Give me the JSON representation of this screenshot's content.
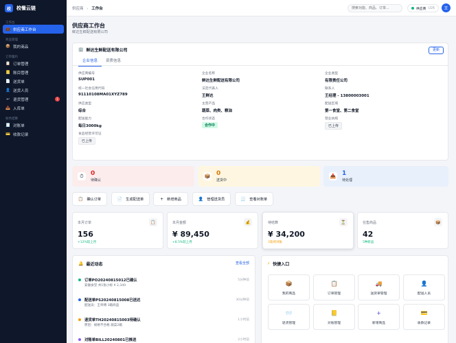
{
  "app": {
    "logo_char": "校",
    "name": "校餐云链"
  },
  "sidebar": {
    "sections": [
      {
        "title": "工作台",
        "items": [
          {
            "label": "供应商工作台",
            "icon": "briefcase-icon",
            "glyph": "💼",
            "active": true
          }
        ]
      },
      {
        "title": "商品管理",
        "items": [
          {
            "label": "我的商品",
            "icon": "box-icon",
            "glyph": "📦"
          }
        ]
      },
      {
        "title": "订单履约",
        "items": [
          {
            "label": "订单管理",
            "icon": "order-icon",
            "glyph": "📋"
          },
          {
            "label": "账目管理",
            "icon": "ledger-icon",
            "glyph": "📒"
          },
          {
            "label": "送货单",
            "icon": "delivery-note-icon",
            "glyph": "📄"
          },
          {
            "label": "送货人员",
            "icon": "courier-icon",
            "glyph": "👤"
          },
          {
            "label": "退货管理",
            "icon": "return-icon",
            "glyph": "↩",
            "badge": "1"
          },
          {
            "label": "入库单",
            "icon": "inbound-icon",
            "glyph": "📥"
          }
        ]
      },
      {
        "title": "财务结算",
        "items": [
          {
            "label": "对账单",
            "icon": "statement-icon",
            "glyph": "🧾"
          },
          {
            "label": "收款记录",
            "icon": "payment-icon",
            "glyph": "💳"
          }
        ]
      }
    ]
  },
  "topbar": {
    "breadcrumb_parent": "供应商",
    "breadcrumb_sep": "›",
    "breadcrumb_current": "工作台",
    "search_placeholder": "搜索功能、商品、订单...",
    "status_label": "供应商",
    "status_version": "U26",
    "avatar": "王"
  },
  "page": {
    "title": "供应商工作台",
    "subtitle": "鲜达生鲜配送有限公司"
  },
  "company": {
    "name": "鲜达生鲜配送有限公司",
    "update_label": "更新",
    "tabs": [
      "企业信息",
      "资质信息"
    ],
    "fields": [
      {
        "label": "供应商编号",
        "value": "SUP001"
      },
      {
        "label": "企业名称",
        "value": "鲜达生鲜配送有限公司"
      },
      {
        "label": "企业类型",
        "value": "有限责任公司"
      },
      {
        "label": "统一社会信用代码",
        "value": "91110108MA01XYZ789"
      },
      {
        "label": "法定代表人",
        "value": "王鲜达"
      },
      {
        "label": "联系人",
        "value": "王经理 - 13800003001"
      },
      {
        "label": "供应类型",
        "value": "综合"
      },
      {
        "label": "主营产品",
        "value": "蔬菜、肉类、粮油"
      },
      {
        "label": "配送区域",
        "value": "第一食堂、第二食堂"
      },
      {
        "label": "配送能力",
        "value": "每日3000kg"
      },
      {
        "label": "合作状态",
        "value": "合作中"
      },
      {
        "label": "营业执照",
        "value": "已上传"
      },
      {
        "label": "食品经营许可证",
        "value": "已上传"
      }
    ]
  },
  "status_cards": [
    {
      "value": "0",
      "label": "待确认",
      "icon": "clock-icon",
      "glyph": "⏱",
      "bg": "#fdecec",
      "color": "#dc2626"
    },
    {
      "value": "0",
      "label": "送货中",
      "icon": "truck-icon",
      "glyph": "📦",
      "bg": "#fef6e0",
      "color": "#d97706"
    },
    {
      "value": "1",
      "label": "待处理",
      "icon": "inbox-icon",
      "glyph": "📥",
      "bg": "#e8f0fc",
      "color": "#2563eb"
    }
  ],
  "quick_buttons": [
    {
      "label": "确认订单",
      "icon": "confirm-order-icon",
      "glyph": "📋"
    },
    {
      "label": "生成配送单",
      "icon": "delivery-icon",
      "glyph": "📄"
    },
    {
      "label": "新增商品",
      "icon": "plus-icon",
      "glyph": "+"
    },
    {
      "label": "管理送货员",
      "icon": "courier-icon",
      "glyph": "👤"
    },
    {
      "label": "查看对账单",
      "icon": "statement-icon",
      "glyph": "🧾"
    }
  ],
  "kpis": [
    {
      "label": "本月订单",
      "value": "156",
      "sub": "+12%较上月",
      "sub_color": "#10b981",
      "icon": "order-icon",
      "glyph": "📋"
    },
    {
      "label": "本月金额",
      "value": "¥ 89,450",
      "sub": "+8.5%较上月",
      "sub_color": "#10b981",
      "icon": "money-bag-icon",
      "glyph": "💰"
    },
    {
      "label": "待结算",
      "value": "¥ 34,200",
      "sub": "3笔待对账",
      "sub_color": "#f59e0b",
      "icon": "hourglass-icon",
      "glyph": "⏳"
    },
    {
      "label": "在售商品",
      "value": "42",
      "sub": "5种新品",
      "sub_color": "#10b981",
      "icon": "box-icon",
      "glyph": "📦"
    }
  ],
  "activity": {
    "title": "最近动态",
    "view_all": "查看全部",
    "items": [
      {
        "title": "订单PO20240815012已确认",
        "desc": "安徽食堂 共1张小标 ¥ 2,340",
        "time": "5分钟前",
        "color": "#10b981"
      },
      {
        "title": "配送单PS20240815008已送达",
        "desc": "配送员：王师傅 3箱商品",
        "time": "30分钟前",
        "color": "#2563eb"
      },
      {
        "title": "退货单TH20240815003待确认",
        "desc": "原因：规格不合格 蔬菜2箱",
        "time": "1小时前",
        "color": "#f59e0b"
      },
      {
        "title": "对账单BILL20240801已推送",
        "desc": "",
        "time": "2小时前",
        "color": "#8b5cf6"
      }
    ]
  },
  "quick_entry": {
    "title": "快捷入口",
    "items": [
      {
        "label": "我的商品",
        "icon": "box-icon",
        "glyph": "📦"
      },
      {
        "label": "订单管理",
        "icon": "order-icon",
        "glyph": "📋"
      },
      {
        "label": "送货单管理",
        "icon": "truck-icon",
        "glyph": "🚚"
      },
      {
        "label": "配送人员",
        "icon": "courier-icon",
        "glyph": "👤"
      },
      {
        "label": "退货管理",
        "icon": "return-icon",
        "glyph": "📨"
      },
      {
        "label": "对账管理",
        "icon": "statement-icon",
        "glyph": "📒"
      },
      {
        "label": "新增商品",
        "icon": "plus-icon",
        "glyph": "+"
      },
      {
        "label": "收款记录",
        "icon": "payment-icon",
        "glyph": "💳"
      }
    ]
  }
}
